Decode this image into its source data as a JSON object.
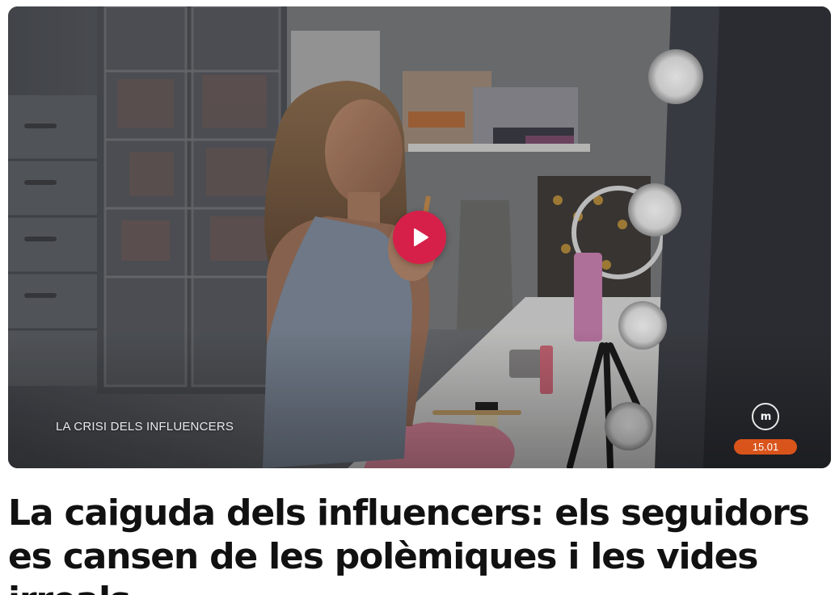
{
  "video": {
    "caption": "LA CRISI DELS INFLUENCERS",
    "channel_logo_text": "m",
    "duration": "15.01",
    "play_icon": "play-icon",
    "accent_color": "#d6204a",
    "badge_color": "#d9541b"
  },
  "article": {
    "headline": "La caiguda dels influencers: els seguidors es cansen de les polèmiques i les vides irreals"
  }
}
